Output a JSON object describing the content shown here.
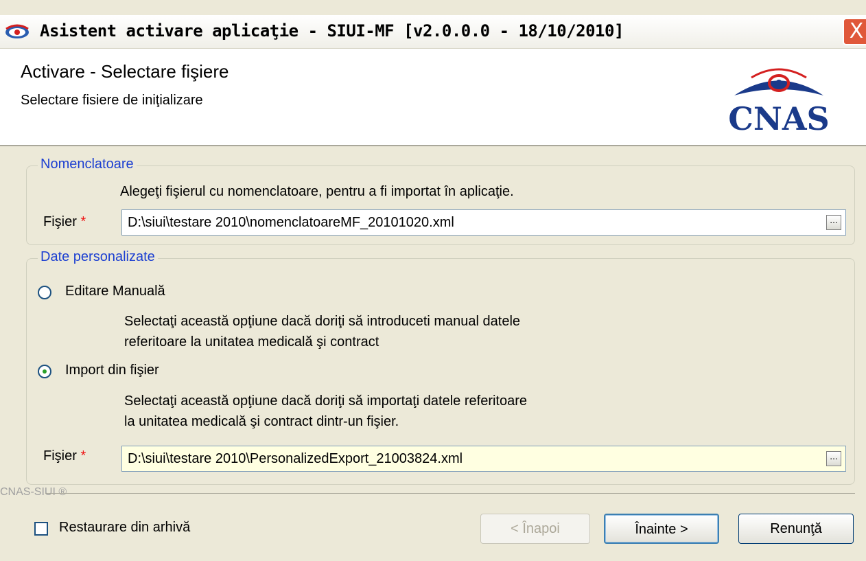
{
  "window": {
    "title": "Asistent activare aplicaţie - SIUI-MF [v2.0.0.0 - 18/10/2010]",
    "close_symbol": "X"
  },
  "header": {
    "title": "Activare - Selectare fişiere",
    "subtitle": "Selectare fisiere de iniţializare",
    "logo_text": "CNAS"
  },
  "nomenclatoare": {
    "legend": "Nomenclatoare",
    "instruction": "Alegeţi fişierul cu nomenclatoare, pentru a fi importat în aplicaţie.",
    "file_label": "Fişier",
    "required_mark": "*",
    "file_value": "D:\\siui\\testare 2010\\nomenclatoareMF_20101020.xml",
    "browse_label": "..."
  },
  "date_personalizate": {
    "legend": "Date personalizate",
    "option_manual": "Editare Manuală",
    "manual_desc_1": "Selectaţi această opţiune dacă doriţi să introduceti manual datele",
    "manual_desc_2": "referitoare la unitatea medicală şi contract",
    "option_import": "Import din fişier",
    "import_desc_1": "Selectaţi această opţiune dacă doriţi să importaţi datele referitoare",
    "import_desc_2": "la unitatea medicală şi contract dintr-un fişier.",
    "file_label": "Fişier",
    "required_mark": "*",
    "file_value": "D:\\siui\\testare 2010\\PersonalizedExport_21003824.xml",
    "browse_label": "...",
    "selected_option": "import"
  },
  "footer": {
    "brand": "CNAS-SIUI ®",
    "restore_label": "Restaurare din arhivă",
    "back_label": "< Înapoi",
    "next_label": "Înainte >",
    "cancel_label": "Renunţă"
  },
  "colors": {
    "accent": "#1c3fd1",
    "required": "#e11111",
    "logo_blue": "#1a3a8a",
    "logo_red": "#d42020"
  }
}
